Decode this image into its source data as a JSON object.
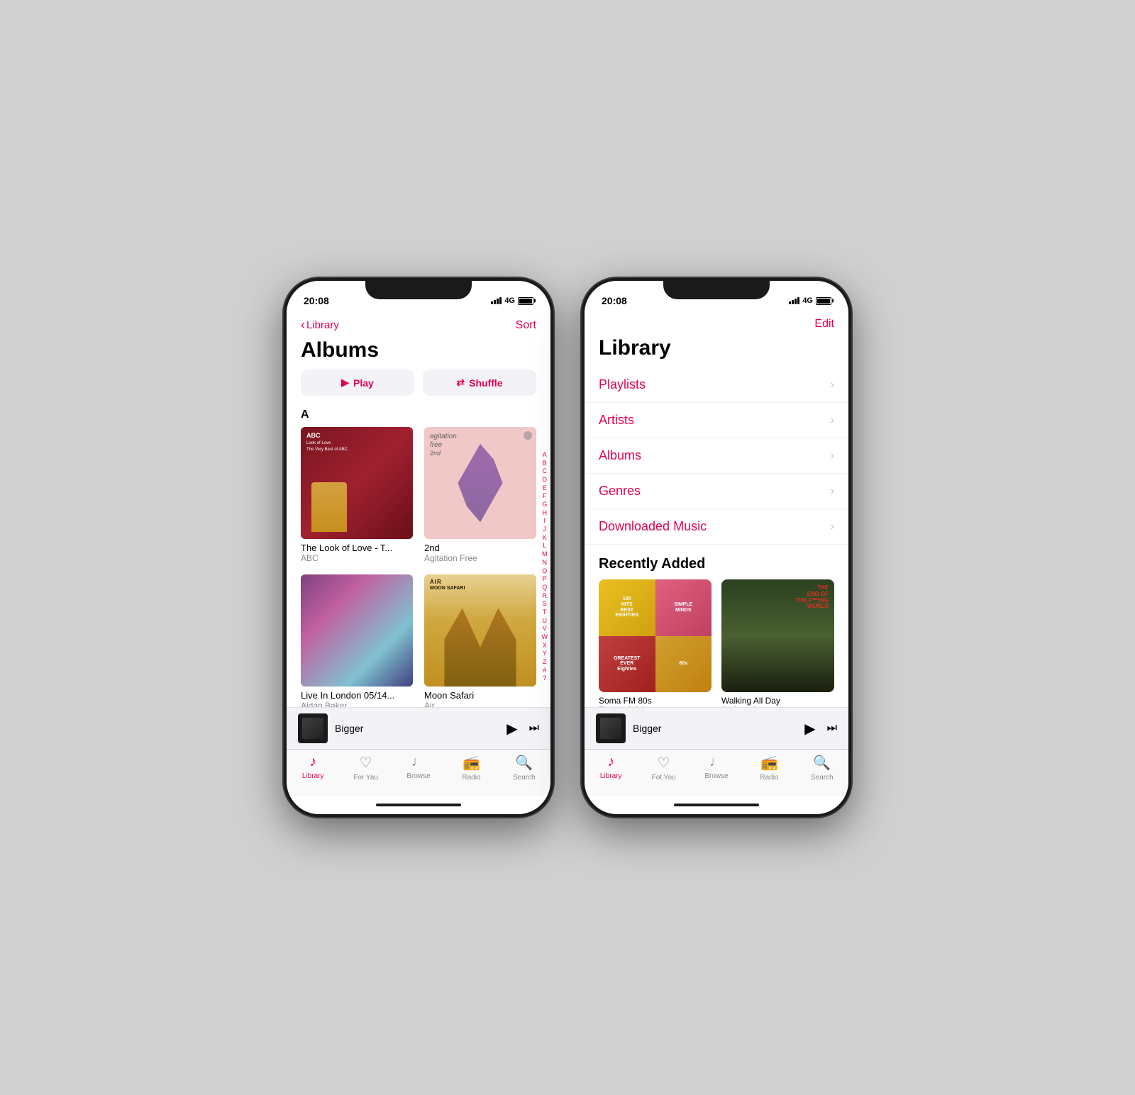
{
  "colors": {
    "accent": "#e5004c",
    "text_primary": "#000000",
    "text_secondary": "#888888",
    "bg_primary": "#ffffff",
    "bg_secondary": "#f2f2f7"
  },
  "left_phone": {
    "status": {
      "time": "20:08",
      "network": "4G"
    },
    "nav": {
      "back_label": "Library",
      "action_label": "Sort"
    },
    "page_title": "Albums",
    "buttons": {
      "play": "Play",
      "shuffle": "Shuffle"
    },
    "section_a": "A",
    "albums": [
      {
        "title": "The Look of Love - T...",
        "artist": "ABC"
      },
      {
        "title": "2nd",
        "artist": "Agitation Free"
      },
      {
        "title": "Live In London 05/14...",
        "artist": "Aidan Baker"
      },
      {
        "title": "Moon Safari",
        "artist": "Air"
      }
    ],
    "alphabet": [
      "A",
      "B",
      "C",
      "D",
      "E",
      "F",
      "G",
      "H",
      "I",
      "J",
      "K",
      "L",
      "M",
      "N",
      "O",
      "P",
      "Q",
      "R",
      "S",
      "T",
      "U",
      "V",
      "W",
      "X",
      "Y",
      "Z",
      "#",
      "?"
    ],
    "now_playing": {
      "title": "Bigger"
    },
    "tabs": [
      {
        "label": "Library",
        "active": true
      },
      {
        "label": "For You",
        "active": false
      },
      {
        "label": "Browse",
        "active": false
      },
      {
        "label": "Radio",
        "active": false
      },
      {
        "label": "Search",
        "active": false
      }
    ]
  },
  "right_phone": {
    "status": {
      "time": "20:08",
      "network": "4G"
    },
    "nav": {
      "action_label": "Edit"
    },
    "page_title": "Library",
    "library_items": [
      {
        "label": "Playlists"
      },
      {
        "label": "Artists"
      },
      {
        "label": "Albums"
      },
      {
        "label": "Genres"
      },
      {
        "label": "Downloaded Music"
      }
    ],
    "recently_added_title": "Recently Added",
    "recent_albums": [
      {
        "title": "Soma FM 80s",
        "artist": "Tim Hardwick"
      },
      {
        "title": "Walking All Day",
        "artist": "Graham Coxon"
      }
    ],
    "now_playing": {
      "title": "Bigger"
    },
    "tabs": [
      {
        "label": "Library",
        "active": true
      },
      {
        "label": "For You",
        "active": false
      },
      {
        "label": "Browse",
        "active": false
      },
      {
        "label": "Radio",
        "active": false
      },
      {
        "label": "Search",
        "active": false
      }
    ]
  }
}
